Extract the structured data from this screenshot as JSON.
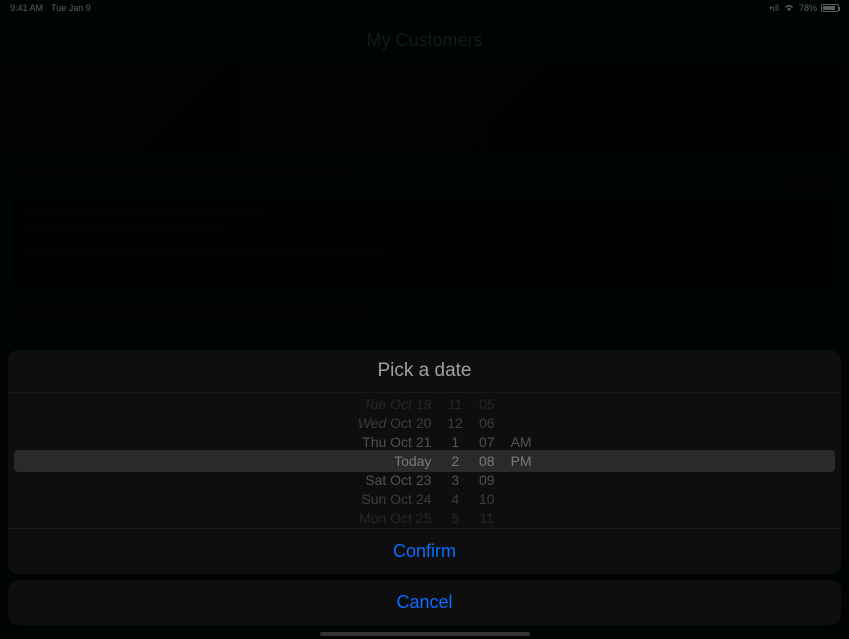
{
  "status": {
    "time": "9:41 AM",
    "date": "Tue Jan 9",
    "battery": "78%"
  },
  "nav": {
    "title": "My Customers"
  },
  "picker": {
    "title": "Pick a date",
    "datewheel": {
      "r0": "Tue Oct 19",
      "r1_prefix": "Wed",
      "r1_rest": " Oct 20",
      "r2_prefix": "Thu",
      "r2_rest": " Oct 21",
      "r3": "Today",
      "r4": "Sat Oct 23",
      "r5": "Sun Oct 24",
      "r6": "Mon Oct 25"
    },
    "hourwheel": {
      "r0": "11",
      "r1": "12",
      "r2": "1",
      "r3": "2",
      "r4": "3",
      "r5": "4",
      "r6": "5"
    },
    "minwheel": {
      "r0": "05",
      "r1": "06",
      "r2": "07",
      "r3": "08",
      "r4": "09",
      "r5": "10",
      "r6": "11"
    },
    "ampmwheel": {
      "r2": "AM",
      "r3": "PM"
    },
    "confirm_label": "Confirm",
    "cancel_label": "Cancel"
  }
}
